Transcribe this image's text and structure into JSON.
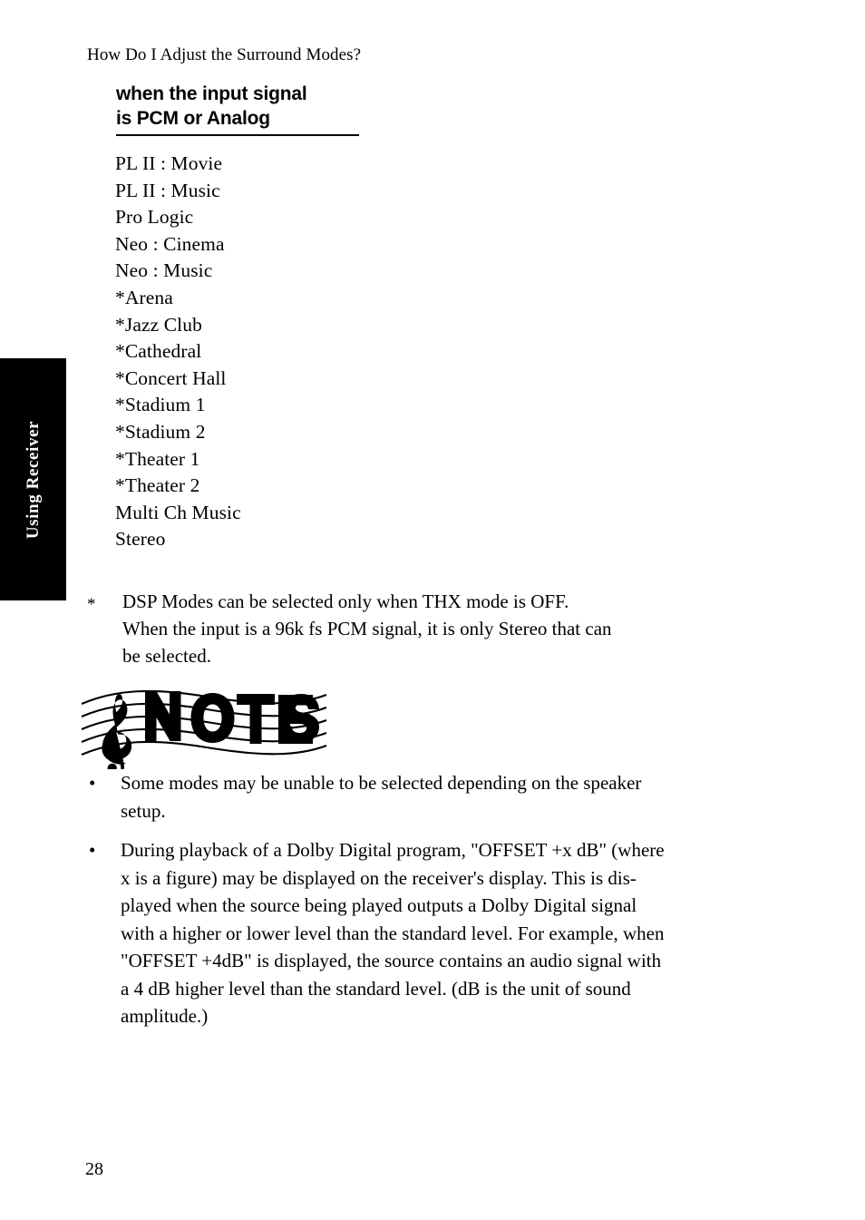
{
  "page": {
    "running_header": "How Do I Adjust the Surround Modes?",
    "page_number": "28"
  },
  "side_tab": {
    "label": "Using Receiver"
  },
  "section": {
    "heading_line1": "when the input signal",
    "heading_line2": "is PCM or Analog"
  },
  "modes": [
    "PL II : Movie",
    "PL II : Music",
    "Pro Logic",
    "Neo : Cinema",
    "Neo : Music",
    "*Arena",
    "*Jazz Club",
    "*Cathedral",
    "*Concert Hall",
    "*Stadium 1",
    "*Stadium 2",
    "*Theater 1",
    "*Theater 2",
    "Multi Ch Music",
    "Stereo"
  ],
  "footnote": {
    "marker": "*",
    "line1": "DSP Modes can be selected only when THX mode is OFF.",
    "line2": "When the input is a 96k fs PCM signal, it is only Stereo that can",
    "line3": "be selected."
  },
  "notes_logo": {
    "word": "NOTES",
    "clef": "treble-clef"
  },
  "notes": [
    {
      "bullet": "•",
      "line1": "Some modes may be unable to be selected depending on the speaker",
      "line2": "setup."
    },
    {
      "bullet": "•",
      "line1": "During playback of a Dolby Digital program, \"OFFSET +x dB\" (where",
      "line2_a": "x is a figure) may be displayed on the receiver's display. This is dis-",
      "line3": "played when the source being played outputs a Dolby Digital signal",
      "line4": "with a higher or lower level than the standard level. For example, when",
      "line5": "\"OFFSET +4dB\" is displayed, the source contains an audio signal with",
      "line6": "a 4 dB higher level than the standard level. (dB is the unit of sound",
      "line7": "amplitude.)"
    }
  ]
}
